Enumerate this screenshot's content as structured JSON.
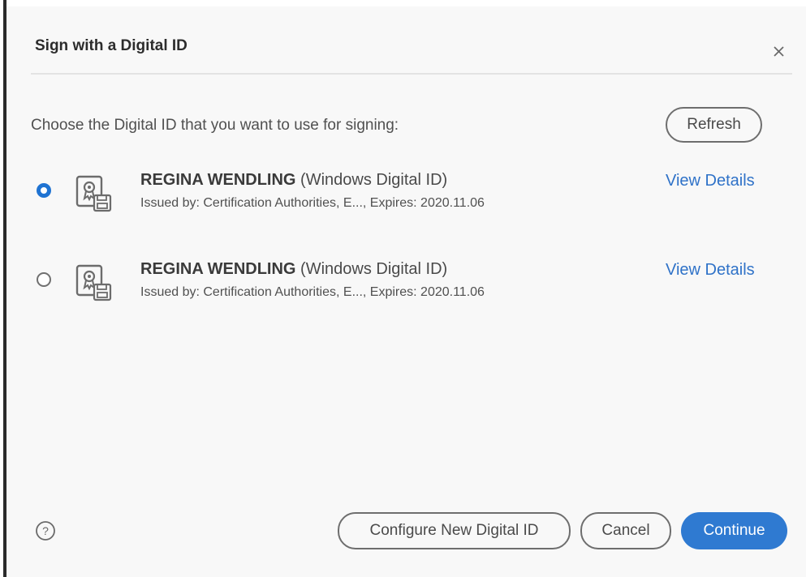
{
  "dialog": {
    "title": "Sign with a Digital ID",
    "close_icon": "close-icon",
    "prompt": "Choose the Digital ID that you want to use for signing:",
    "refresh_label": "Refresh"
  },
  "digital_ids": [
    {
      "name": "REGINA WENDLING",
      "type": "(Windows Digital ID)",
      "issuer_line": "Issued by: Certification Authorities, E..., Expires: 2020.11.06",
      "selected": true,
      "view_details_label": "View Details",
      "icon": "certificate-icon"
    },
    {
      "name": "REGINA WENDLING",
      "type": "(Windows Digital ID)",
      "issuer_line": "Issued by: Certification Authorities, E..., Expires: 2020.11.06",
      "selected": false,
      "view_details_label": "View Details",
      "icon": "certificate-icon"
    }
  ],
  "footer": {
    "help_icon": "help-icon",
    "configure_label": "Configure New Digital ID",
    "cancel_label": "Cancel",
    "continue_label": "Continue"
  },
  "colors": {
    "accent": "#2f7ad1",
    "link": "#2f72c8",
    "background": "#f8f8f8"
  }
}
